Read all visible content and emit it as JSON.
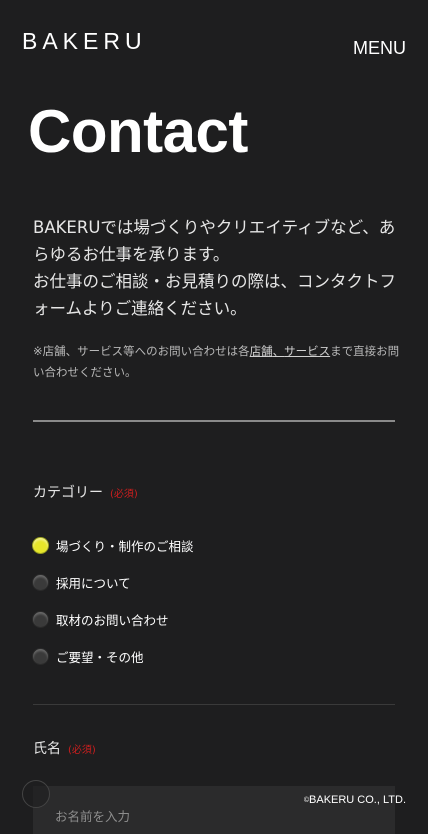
{
  "header": {
    "logo": "BAKERU",
    "menu_label": "MENU"
  },
  "page": {
    "title": "Contact"
  },
  "intro": {
    "line1": "BAKERUでは場づくりやクリエイティブなど、あらゆるお仕事を承ります。",
    "line2": "お仕事のご相談・お見積りの際は、コンタクトフォームよりご連絡ください。"
  },
  "note": {
    "prefix": "※店舗、サービス等へのお問い合わせは各",
    "link_store": "店舗",
    "separator": "、",
    "link_service": "サービス",
    "suffix": "まで直接お問い合わせください。"
  },
  "form": {
    "category": {
      "label": "カテゴリー",
      "required": "(必須)",
      "options": [
        {
          "label": "場づくり・制作のご相談",
          "checked": true
        },
        {
          "label": "採用について",
          "checked": false
        },
        {
          "label": "取材のお問い合わせ",
          "checked": false
        },
        {
          "label": "ご要望・その他",
          "checked": false
        }
      ]
    },
    "name": {
      "label": "氏名",
      "required": "(必須)",
      "placeholder": "お名前を入力",
      "value": ""
    }
  },
  "footer": {
    "copyright_symbol": "©",
    "copyright": "BAKERU CO., LTD."
  },
  "colors": {
    "background": "#1e1e1f",
    "accent_checked": "#e6e62a",
    "required": "#cc1e1e"
  }
}
